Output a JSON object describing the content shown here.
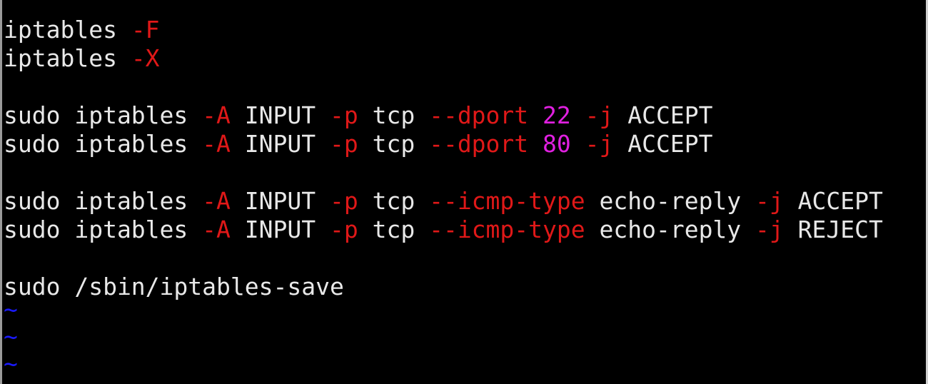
{
  "editor": {
    "lines": [
      [
        {
          "text": "iptables ",
          "color": "white"
        },
        {
          "text": "-F",
          "color": "red"
        }
      ],
      [
        {
          "text": "iptables ",
          "color": "white"
        },
        {
          "text": "-X",
          "color": "red"
        }
      ],
      [],
      [
        {
          "text": "sudo iptables ",
          "color": "white"
        },
        {
          "text": "-A",
          "color": "red"
        },
        {
          "text": " INPUT ",
          "color": "white"
        },
        {
          "text": "-p",
          "color": "red"
        },
        {
          "text": " tcp ",
          "color": "white"
        },
        {
          "text": "--dport",
          "color": "red"
        },
        {
          "text": " ",
          "color": "white"
        },
        {
          "text": "22",
          "color": "magenta"
        },
        {
          "text": " ",
          "color": "white"
        },
        {
          "text": "-j",
          "color": "red"
        },
        {
          "text": " ACCEPT",
          "color": "white"
        }
      ],
      [
        {
          "text": "sudo iptables ",
          "color": "white"
        },
        {
          "text": "-A",
          "color": "red"
        },
        {
          "text": " INPUT ",
          "color": "white"
        },
        {
          "text": "-p",
          "color": "red"
        },
        {
          "text": " tcp ",
          "color": "white"
        },
        {
          "text": "--dport",
          "color": "red"
        },
        {
          "text": " ",
          "color": "white"
        },
        {
          "text": "80",
          "color": "magenta"
        },
        {
          "text": " ",
          "color": "white"
        },
        {
          "text": "-j",
          "color": "red"
        },
        {
          "text": " ACCEPT",
          "color": "white"
        }
      ],
      [],
      [
        {
          "text": "sudo iptables ",
          "color": "white"
        },
        {
          "text": "-A",
          "color": "red"
        },
        {
          "text": " INPUT ",
          "color": "white"
        },
        {
          "text": "-p",
          "color": "red"
        },
        {
          "text": " tcp ",
          "color": "white"
        },
        {
          "text": "--icmp-type",
          "color": "red"
        },
        {
          "text": " echo-reply ",
          "color": "white"
        },
        {
          "text": "-j",
          "color": "red"
        },
        {
          "text": " ACCEPT",
          "color": "white"
        }
      ],
      [
        {
          "text": "sudo iptables ",
          "color": "white"
        },
        {
          "text": "-A",
          "color": "red"
        },
        {
          "text": " INPUT ",
          "color": "white"
        },
        {
          "text": "-p",
          "color": "red"
        },
        {
          "text": " tcp ",
          "color": "white"
        },
        {
          "text": "--icmp-type",
          "color": "red"
        },
        {
          "text": " echo-reply ",
          "color": "white"
        },
        {
          "text": "-j",
          "color": "red"
        },
        {
          "text": " REJECT",
          "color": "white"
        }
      ],
      [],
      [
        {
          "text": "sudo /sbin/iptables-save",
          "color": "white"
        }
      ]
    ],
    "tildes": [
      "~",
      "~",
      "~"
    ],
    "colors": {
      "background": "#000000",
      "text": "#e8e8e8",
      "option": "#e01818",
      "number": "#e020e0",
      "tilde": "#1a1aff"
    }
  }
}
